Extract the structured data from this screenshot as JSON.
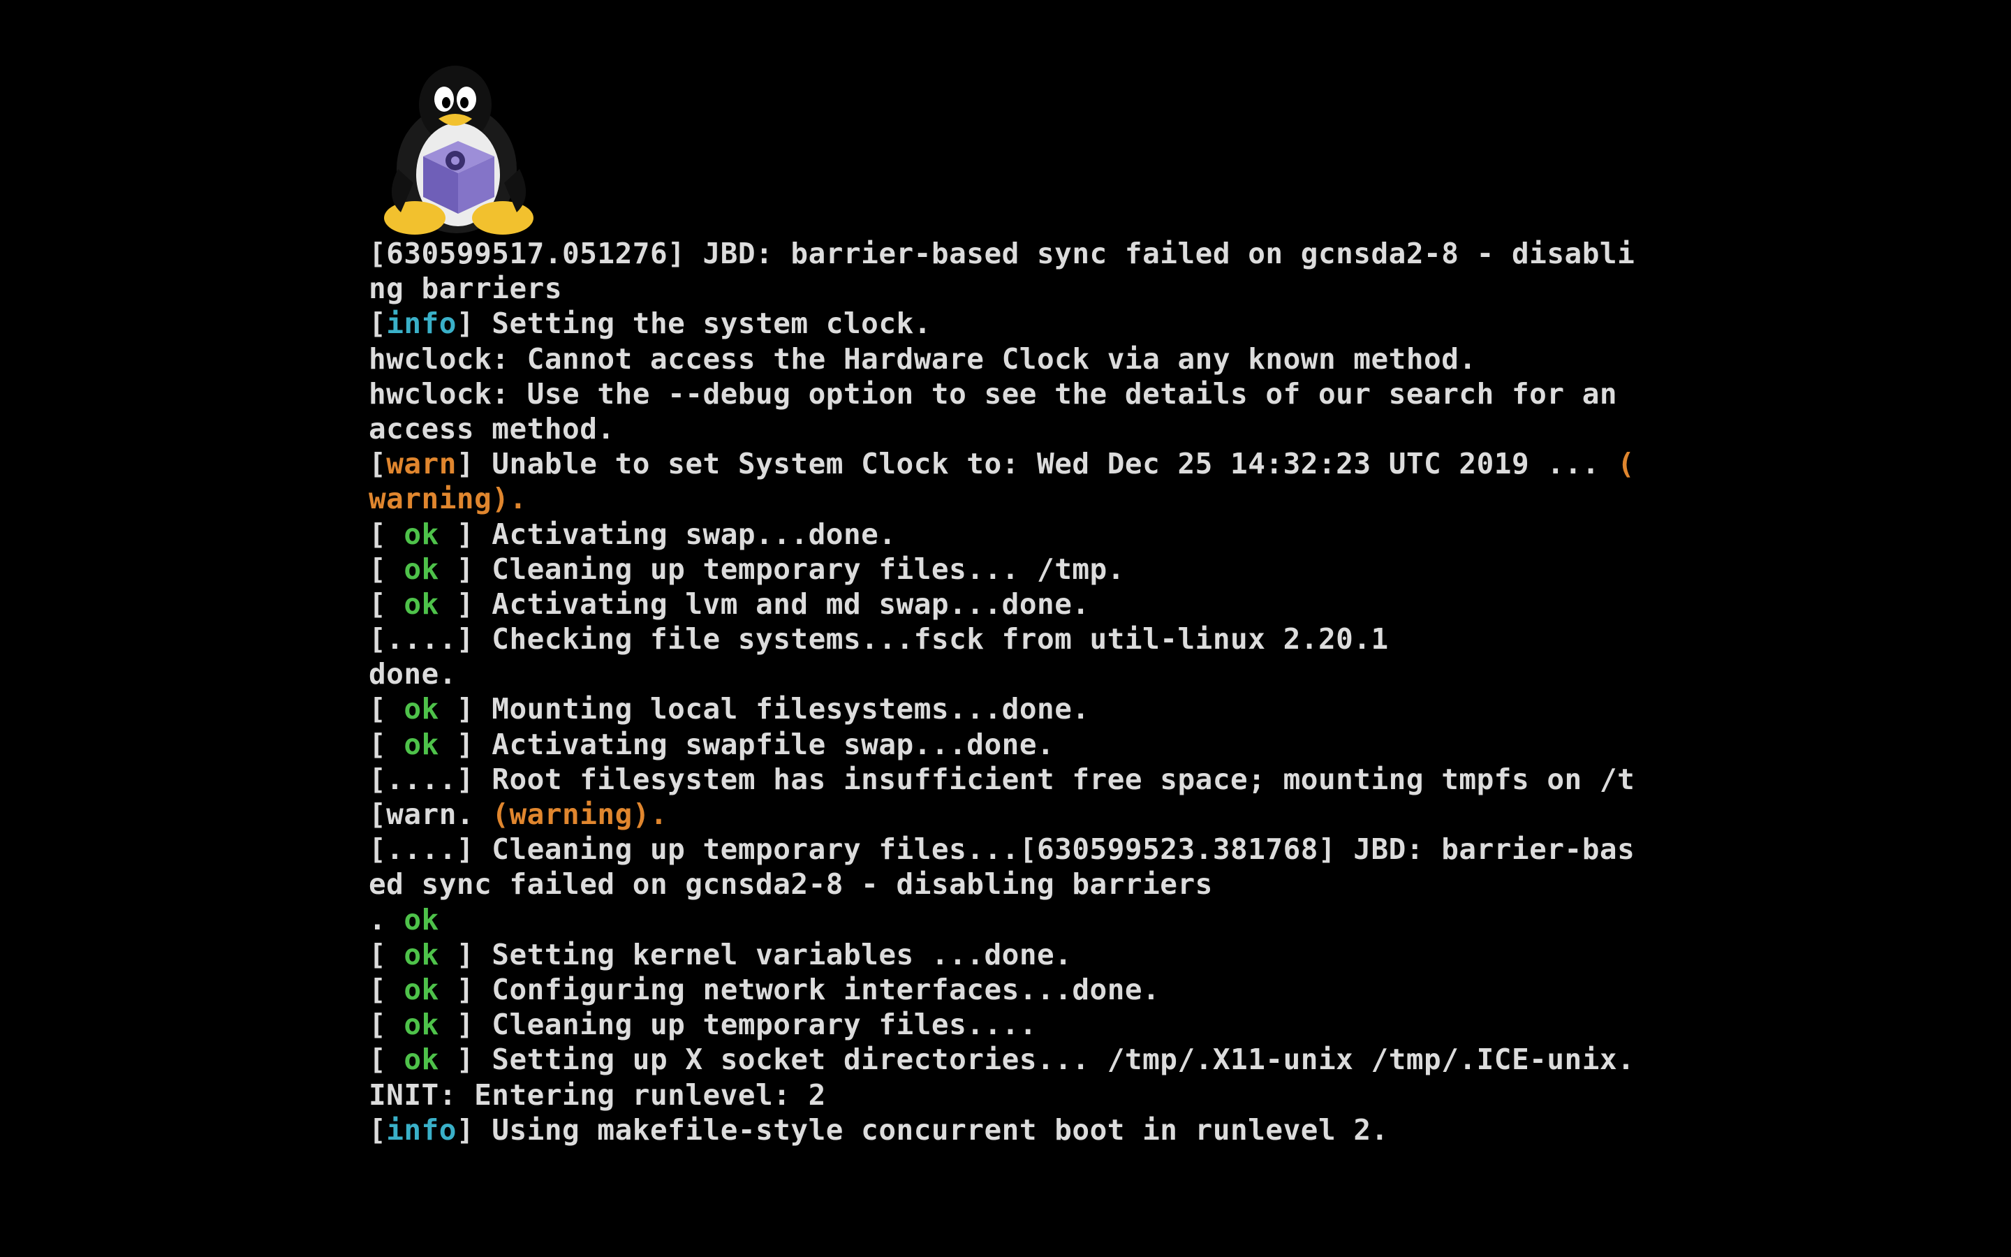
{
  "logo": {
    "icon": "tux-gamecube-icon"
  },
  "colors": {
    "background": "#000000",
    "text": "#dcdcdc",
    "info": "#3ab0c8",
    "warn": "#e0862e",
    "ok": "#4ec24a"
  },
  "console": {
    "lines": [
      [
        {
          "t": "[630599517.051276] JBD: barrier-based sync failed on gcnsda2-8 - disabli"
        }
      ],
      [
        {
          "t": "ng barriers"
        }
      ],
      [
        {
          "t": "["
        },
        {
          "t": "info",
          "c": "info"
        },
        {
          "t": "] Setting the system clock."
        }
      ],
      [
        {
          "t": "hwclock: Cannot access the Hardware Clock via any known method."
        }
      ],
      [
        {
          "t": "hwclock: Use the --debug option to see the details of our search for an"
        }
      ],
      [
        {
          "t": "access method."
        }
      ],
      [
        {
          "t": "["
        },
        {
          "t": "warn",
          "c": "warn"
        },
        {
          "t": "] Unable to set System Clock to: Wed Dec 25 14:32:23 UTC 2019 ... "
        },
        {
          "t": "(",
          "c": "warn"
        }
      ],
      [
        {
          "t": "warning).",
          "c": "warn"
        }
      ],
      [
        {
          "t": "[ "
        },
        {
          "t": "ok",
          "c": "ok"
        },
        {
          "t": " ] Activating swap...done."
        }
      ],
      [
        {
          "t": "[ "
        },
        {
          "t": "ok",
          "c": "ok"
        },
        {
          "t": " ] Cleaning up temporary files... /tmp."
        }
      ],
      [
        {
          "t": "[ "
        },
        {
          "t": "ok",
          "c": "ok"
        },
        {
          "t": " ] Activating lvm and md swap...done."
        }
      ],
      [
        {
          "t": "[....] Checking file systems...fsck from util-linux 2.20.1"
        }
      ],
      [
        {
          "t": "done."
        }
      ],
      [
        {
          "t": "[ "
        },
        {
          "t": "ok",
          "c": "ok"
        },
        {
          "t": " ] Mounting local filesystems...done."
        }
      ],
      [
        {
          "t": "[ "
        },
        {
          "t": "ok",
          "c": "ok"
        },
        {
          "t": " ] Activating swapfile swap...done."
        }
      ],
      [
        {
          "t": "[....] Root filesystem has insufficient free space; mounting tmpfs on /t"
        }
      ],
      [
        {
          "t": "[warn. "
        },
        {
          "t": "(warning).",
          "c": "warn"
        }
      ],
      [
        {
          "t": "[....] Cleaning up temporary files...[630599523.381768] JBD: barrier-bas"
        }
      ],
      [
        {
          "t": "ed sync failed on gcnsda2-8 - disabling barriers"
        }
      ],
      [
        {
          "t": ". "
        },
        {
          "t": "ok",
          "c": "ok"
        }
      ],
      [
        {
          "t": "[ "
        },
        {
          "t": "ok",
          "c": "ok"
        },
        {
          "t": " ] Setting kernel variables ...done."
        }
      ],
      [
        {
          "t": "[ "
        },
        {
          "t": "ok",
          "c": "ok"
        },
        {
          "t": " ] Configuring network interfaces...done."
        }
      ],
      [
        {
          "t": "[ "
        },
        {
          "t": "ok",
          "c": "ok"
        },
        {
          "t": " ] Cleaning up temporary files...."
        }
      ],
      [
        {
          "t": "[ "
        },
        {
          "t": "ok",
          "c": "ok"
        },
        {
          "t": " ] Setting up X socket directories... /tmp/.X11-unix /tmp/.ICE-unix."
        }
      ],
      [
        {
          "t": "INIT: Entering runlevel: 2"
        }
      ],
      [
        {
          "t": "["
        },
        {
          "t": "info",
          "c": "info"
        },
        {
          "t": "] Using makefile-style concurrent boot in runlevel 2."
        }
      ]
    ]
  }
}
